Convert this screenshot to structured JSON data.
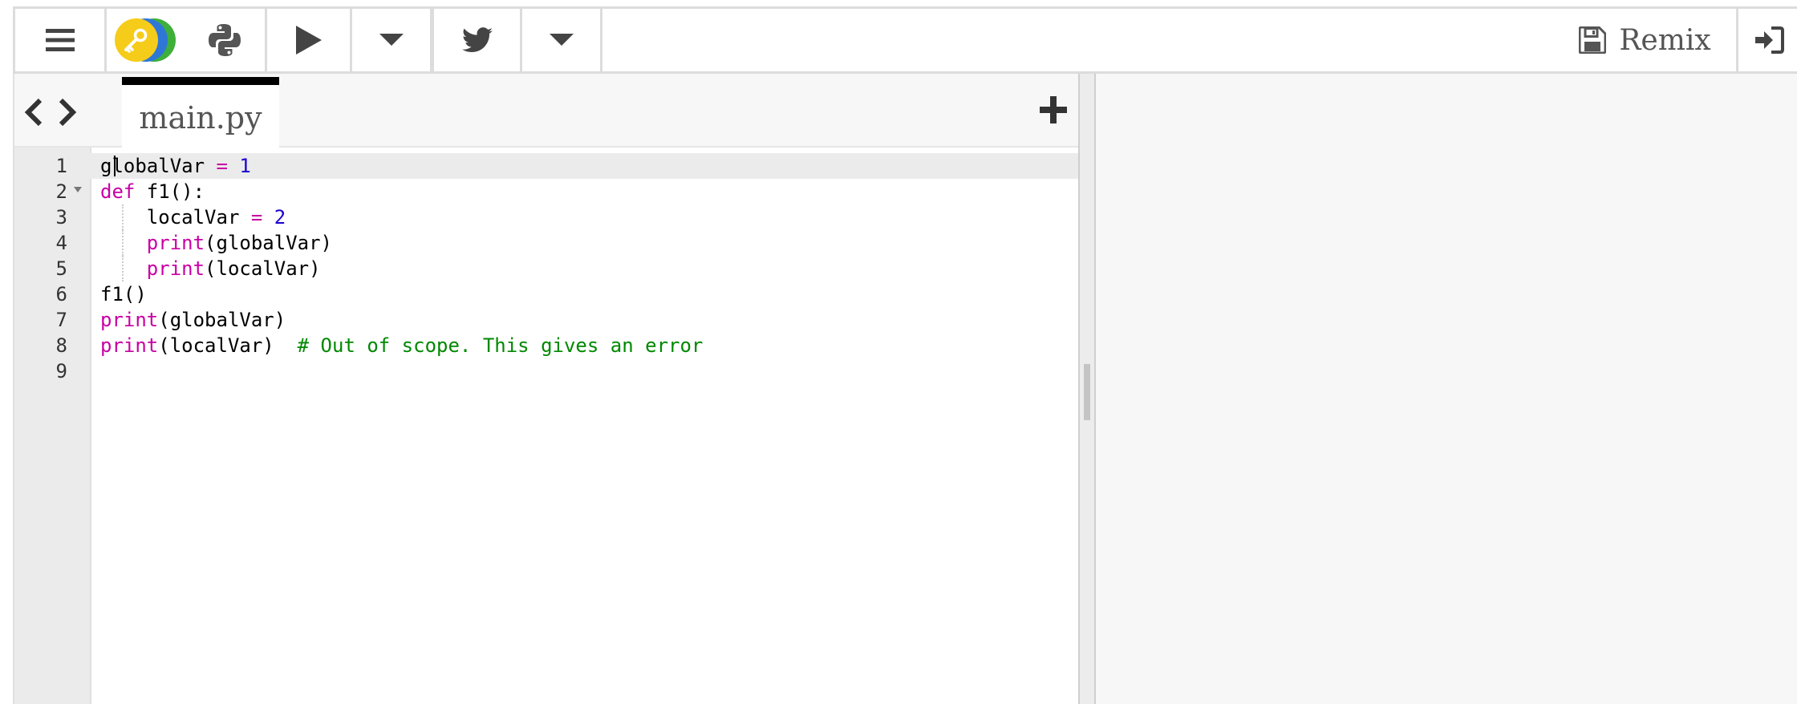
{
  "toolbar": {
    "menu_icon": "hamburger-menu-icon",
    "logo_icon": "trinket-key-logo",
    "python_icon": "python-logo-icon",
    "run_icon": "play-icon",
    "run_options_icon": "caret-down-icon",
    "share_icon": "twitter-icon",
    "share_options_icon": "caret-down-icon",
    "remix_label": "Remix",
    "remix_icon": "floppy-disk-icon",
    "login_icon": "sign-in-icon"
  },
  "editor": {
    "nav_back_icon": "chevron-left-icon",
    "nav_forward_icon": "chevron-right-icon",
    "active_file": "main.py",
    "add_file_icon": "plus-icon",
    "active_line": 1,
    "lines": [
      {
        "num": "1",
        "text": "globalVar = 1"
      },
      {
        "num": "2",
        "text": "def f1():"
      },
      {
        "num": "3",
        "text": "    localVar = 2"
      },
      {
        "num": "4",
        "text": "    print(globalVar)"
      },
      {
        "num": "5",
        "text": "    print(localVar)"
      },
      {
        "num": "6",
        "text": "f1()"
      },
      {
        "num": "7",
        "text": "print(globalVar)"
      },
      {
        "num": "8",
        "text": "print(localVar)  # Out of scope. This gives an error"
      },
      {
        "num": "9",
        "text": ""
      }
    ]
  },
  "colors": {
    "keyword": "#c800a4",
    "number": "#1c00cf",
    "comment": "#008800",
    "active_line_bg": "#ebebeb",
    "output_bg": "#f7f7f7"
  }
}
